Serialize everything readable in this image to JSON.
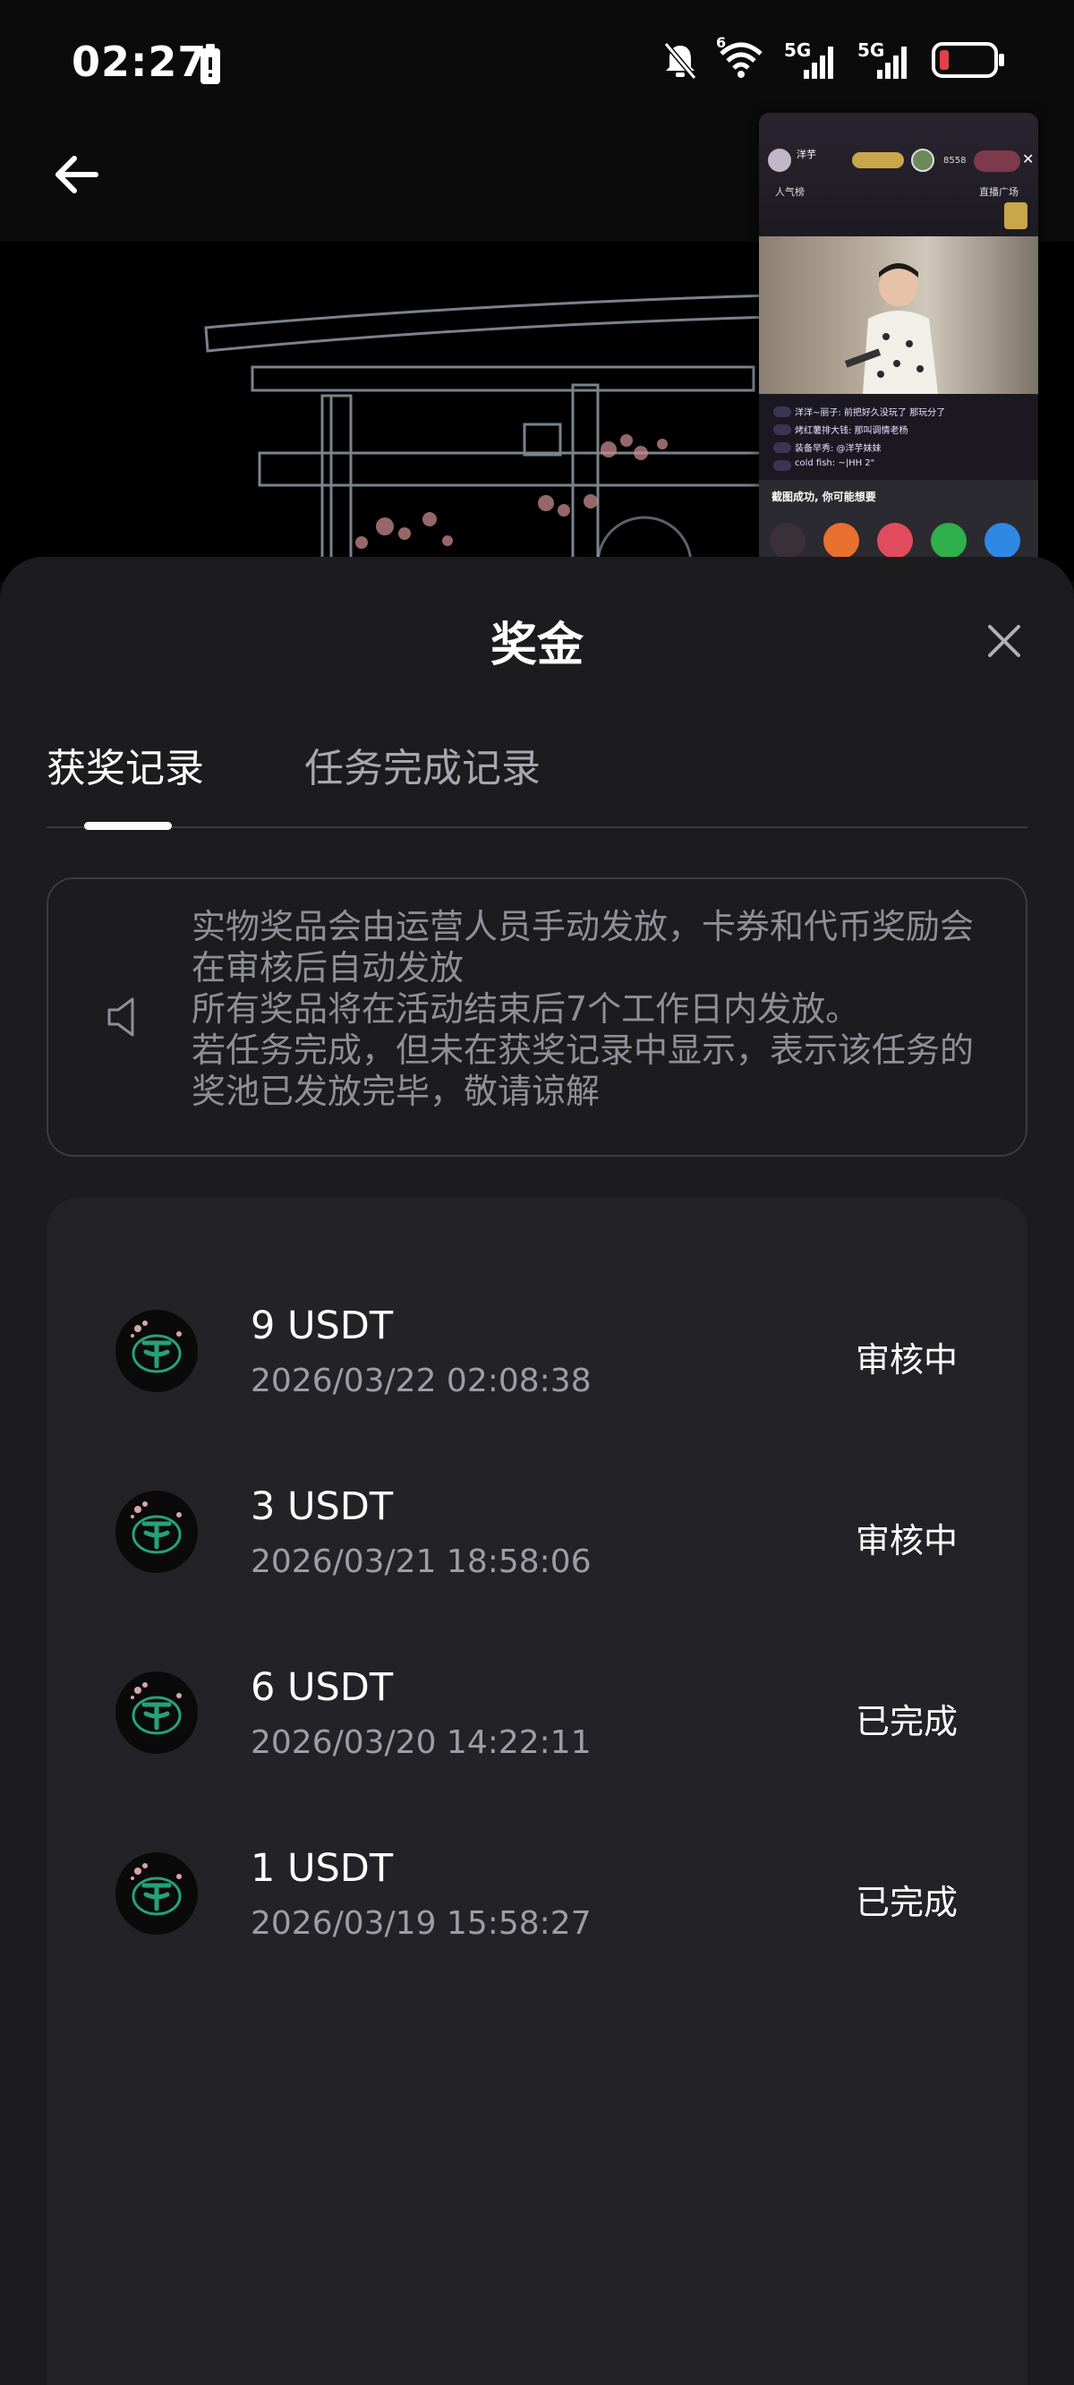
{
  "status_bar": {
    "time": "02:27",
    "net1": "5G",
    "net2": "5G",
    "wifi_badge": "6"
  },
  "header": {
    "back_icon": "arrow-left-icon"
  },
  "pip": {
    "host_name": "洋芋",
    "viewers": "8558",
    "rank_label": "人气榜",
    "plaza_label": "直播广场",
    "chat": [
      "洋洋~丽子: 前把好久没玩了 那玩分了",
      "烤红薯排大钱: 那叫调情老杨",
      "装备早秀: @洋芋妹妹",
      "cold fish: ~|HH 2\""
    ],
    "screenshot_msg": "截图成功, 你可能想要"
  },
  "sheet": {
    "title": "奖金",
    "tabs": [
      {
        "label": "获奖记录",
        "active": true
      },
      {
        "label": "任务完成记录",
        "active": false
      }
    ],
    "notice_lines": [
      "实物奖品会由运营人员手动发放，卡券和代币奖励会在审核后自动发放",
      "所有奖品将在活动结束后7个工作日内发放。",
      "若任务完成，但未在获奖记录中显示，表示该任务的奖池已发放完毕，敬请谅解"
    ],
    "records": [
      {
        "amount": "9 USDT",
        "time": "2026/03/22 02:08:38",
        "status": "审核中"
      },
      {
        "amount": "3 USDT",
        "time": "2026/03/21 18:58:06",
        "status": "审核中"
      },
      {
        "amount": "6 USDT",
        "time": "2026/03/20 14:22:11",
        "status": "已完成"
      },
      {
        "amount": "1 USDT",
        "time": "2026/03/19 15:58:27",
        "status": "已完成"
      }
    ]
  },
  "colors": {
    "sheet_bg": "#1c1c1f",
    "card_bg": "#232327",
    "tether_green": "#26a17b"
  }
}
